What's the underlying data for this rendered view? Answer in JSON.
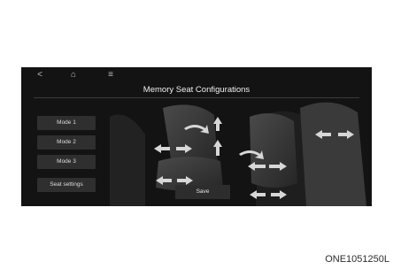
{
  "topbar": {
    "back_icon": "<",
    "home_icon": "⌂",
    "menu_icon": "≡"
  },
  "title": "Memory Seat Configurations",
  "modes": [
    {
      "label": "Mode 1"
    },
    {
      "label": "Mode 2"
    },
    {
      "label": "Mode 3"
    },
    {
      "label": "Seat settings"
    }
  ],
  "save_label": "Save",
  "caption": "ONE1051250L",
  "colors": {
    "screen_bg": "#131313",
    "button_bg": "#2f2f2f",
    "arrow": "#d7d7d7"
  }
}
